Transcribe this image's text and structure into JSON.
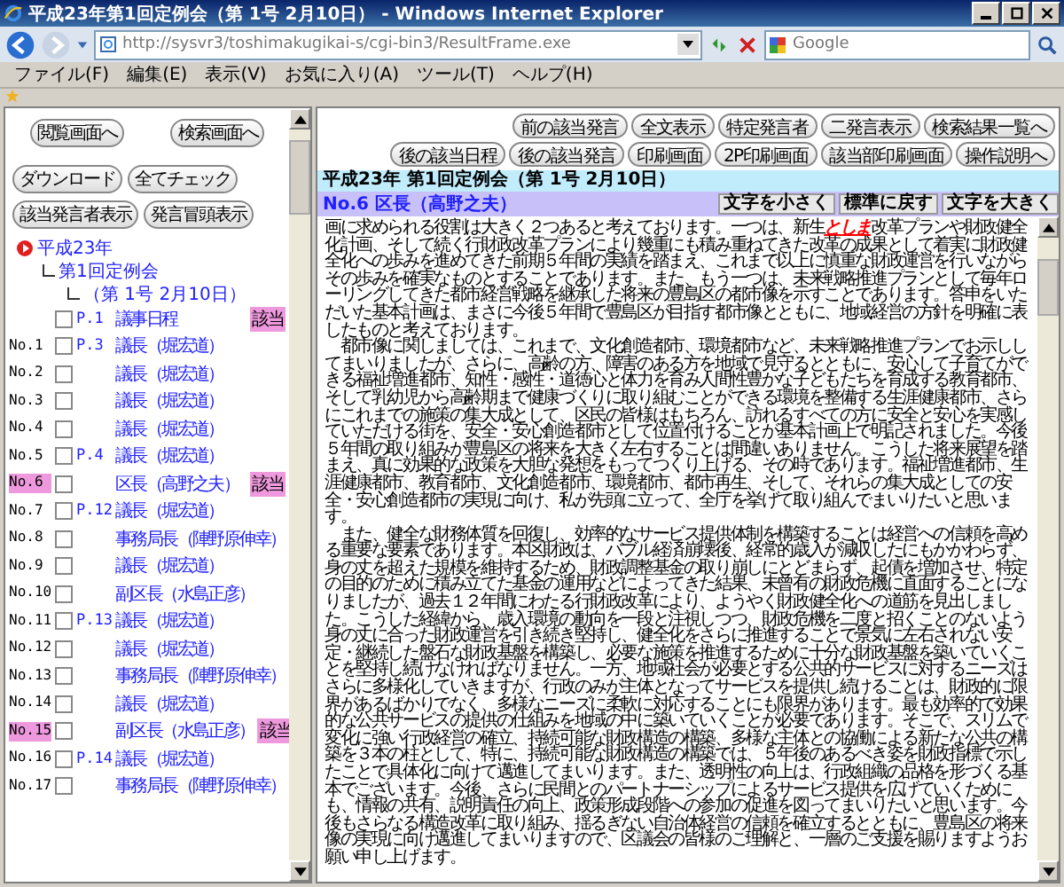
{
  "window": {
    "title": "平成23年第1回定例会（第 1号 2月10日） - Windows Internet Explorer"
  },
  "address_bar": {
    "url": "http://sysvr3/toshimakugikai-s/cgi-bin3/ResultFrame.exe"
  },
  "search": {
    "placeholder": "Google"
  },
  "menu": [
    "ファイル(F)",
    "編集(E)",
    "表示(V)",
    "お気に入り(A)",
    "ツール(T)",
    "ヘルプ(H)"
  ],
  "sidebar": {
    "buttons": [
      [
        "閲覧画面へ",
        "検索画面へ"
      ],
      [
        "ダウンロード",
        "全てチェック"
      ],
      [
        "該当発言者表示",
        "発言冒頭表示"
      ]
    ],
    "tree": [
      {
        "label": "平成23年",
        "expanded": true,
        "children": [
          {
            "label": "第1回定例会",
            "children": [
              {
                "label": "（第 1号 2月10日）"
              }
            ]
          }
        ]
      }
    ],
    "rows": [
      {
        "no": "",
        "page": "P.1",
        "name": "議事日程",
        "checked": false,
        "hit": false,
        "tag": "該当"
      },
      {
        "no": "No.1",
        "page": "P.3",
        "name": "議長（堀宏道）",
        "checked": false,
        "hit": false
      },
      {
        "no": "No.2",
        "page": "",
        "name": "議長（堀宏道）",
        "checked": false,
        "hit": false
      },
      {
        "no": "No.3",
        "page": "",
        "name": "議長（堀宏道）",
        "checked": false,
        "hit": false
      },
      {
        "no": "No.4",
        "page": "",
        "name": "議長（堀宏道）",
        "checked": false,
        "hit": false
      },
      {
        "no": "No.5",
        "page": "P.4",
        "name": "議長（堀宏道）",
        "checked": false,
        "hit": false
      },
      {
        "no": "No.6",
        "page": "",
        "name": "区長（高野之夫）",
        "checked": false,
        "hit": true,
        "tag": "該当"
      },
      {
        "no": "No.7",
        "page": "P.12",
        "name": "議長（堀宏道）",
        "checked": false,
        "hit": false
      },
      {
        "no": "No.8",
        "page": "",
        "name": "事務局長（陣野原伸幸）",
        "checked": false,
        "hit": false
      },
      {
        "no": "No.9",
        "page": "",
        "name": "議長（堀宏道）",
        "checked": false,
        "hit": false
      },
      {
        "no": "No.10",
        "page": "",
        "name": "副区長（水島正彦）",
        "checked": false,
        "hit": false
      },
      {
        "no": "No.11",
        "page": "P.13",
        "name": "議長（堀宏道）",
        "checked": false,
        "hit": false
      },
      {
        "no": "No.12",
        "page": "",
        "name": "議長（堀宏道）",
        "checked": false,
        "hit": false
      },
      {
        "no": "No.13",
        "page": "",
        "name": "事務局長（陣野原伸幸）",
        "checked": false,
        "hit": false
      },
      {
        "no": "No.14",
        "page": "",
        "name": "議長（堀宏道）",
        "checked": false,
        "hit": false
      },
      {
        "no": "No.15",
        "page": "",
        "name": "副区長（水島正彦）",
        "checked": false,
        "hit": true,
        "tag": "該当"
      },
      {
        "no": "No.16",
        "page": "P.14",
        "name": "議長（堀宏道）",
        "checked": false,
        "hit": false
      },
      {
        "no": "No.17",
        "page": "",
        "name": "事務局長（陣野原伸幸）",
        "checked": false,
        "hit": false
      }
    ]
  },
  "nav_buttons": [
    [
      "前の該当発言",
      "全文表示",
      "特定発言者",
      "二発言表示",
      "検索結果一覧へ"
    ],
    [
      "後の該当日程",
      "後の該当発言",
      "印刷画面",
      "2P印刷画面",
      "該当部印刷画面",
      "操作説明へ"
    ]
  ],
  "session_title": "平成23年 第1回定例会（第 1号 2月10日）",
  "speaker": "No.6 区長（高野之夫）",
  "font_buttons": [
    "文字を小さく",
    "標準に戻す",
    "文字を大きく"
  ],
  "paragraphs": [
    [
      {
        "text": "画に求められる役割は大きく２つあると考えております。一つは、新生",
        "highlight": false
      },
      {
        "text": "としま",
        "highlight": true
      },
      {
        "text": "改革プランや財政健全化計画、そして続く行財政改革プランにより幾重にも積み重ねてきた改革の成果として着実に財政健全化への歩みを進めてきた前期５年間の実績を踏まえ、これまで以上に慎重な財政運営を行いながらその歩みを確実なものとすることであります。また、もう一つは、未来戦略推進プランとして毎年ローリングしてきた都市経営戦略を継承した将来の豊島区の都市像を示すことであります。答申をいただいた基本計画は、まさに今後５年間で豊島区が目指す都市像とともに、地域経営の方針を明確に表したものと考えております。",
        "highlight": false
      }
    ],
    [
      {
        "text": "　都市像に関しましては、これまで、文化創造都市、環境都市など、未来戦略推進プランでお示ししてまいりましたが、さらに、高齢の方、障害のある方を地域で見守るとともに、安心して子育てができる福祉増進都市、知性・感性・道徳心と体力を育み人間性豊かな子どもたちを育成する教育都市、そして乳幼児から高齢期まで健康づくりに取り組むことができる環境を整備する生涯健康都市、さらにこれまでの施策の集大成として、区民の皆様はもちろん、訪れるすべての方に安全と安心を実感していただける街を、安全・安心創造都市として位置付けることが基本計画上で明記されました。今後５年間の取り組みが豊島区の将来を大きく左右することは間違いありません。こうした将来展望を踏まえ、真に効果的な政策を大胆な発想をもってつくり上げる、その時であります。福祉増進都市、生涯健康都市、教育都市、文化創造都市、環境都市、都市再生、そして、それらの集大成としての安全・安心創造都市の実現に向け、私が先頭に立って、全庁を挙げて取り組んでまいりたいと思います。",
        "highlight": false
      }
    ],
    [
      {
        "text": "　また、健全な財務体質を回復し、効率的なサービス提供体制を構築することは経営への信頼を高める重要な要素であります。本区財政は、バブル経済崩壊後、経常的歳入が減収したにもかかわらず、身の丈を超えた規模を維持するため、財政調整基金の取り崩しにとどまらず、起債を増加させ、特定の目的のために積み立てた基金の運用などによってきた結果、未曾有の財政危機に直面することになりましたが、過去１２年間にわたる行財政改革により、ようやく財政健全化への道筋を見出しました。こうした経緯から、歳入環境の動向を一段と注視しつつ、財政危機を二度と招くことのないよう身の丈に合った財政運営を引き続き堅持し、健全化をさらに推進することで景気に左右されない安定・継続した盤石な財政基盤を構築し、必要な施策を推進するために十分な財政基盤を築いていくことを堅持し続けなければなりません。一方、地域社会が必要とする公共的サービスに対するニーズはさらに多様化していきますが、行政のみが主体となってサービスを提供し続けることは、財政的に限界があるばかりでなく、多様なニーズに柔軟に対応することにも限界があります。最も効率的で効果的な公共サービスの提供の仕組みを地域の中に築いていくことが必要であります。そこで、スリムで変化に強い行政経営の確立、持続可能な財政構造の構築、多様な主体との協働による新たな公共の構築を３本の柱として、特に、持続可能な財政構造の構築では、５年後のあるべき姿を財政指標で示したことで具体化に向けて邁進してまいります。また、透明性の向上は、行政組織の品格を形づくる基本でございます。今後、さらに民間とのパートナーシップによるサービス提供を広げていくためにも、情報の共有、説明責任の向上、政策形成段階への参加の促進を図ってまいりたいと思います。今後もさらなる構造改革に取り組み、揺るぎない自治体経営の信頼を確立するとともに、豊島区の将来像の実現に向け邁進してまいりますので、区議会の皆様のご理解と、一層のご支援を賜りますようお願い申し上げます。",
        "highlight": false
      }
    ]
  ]
}
